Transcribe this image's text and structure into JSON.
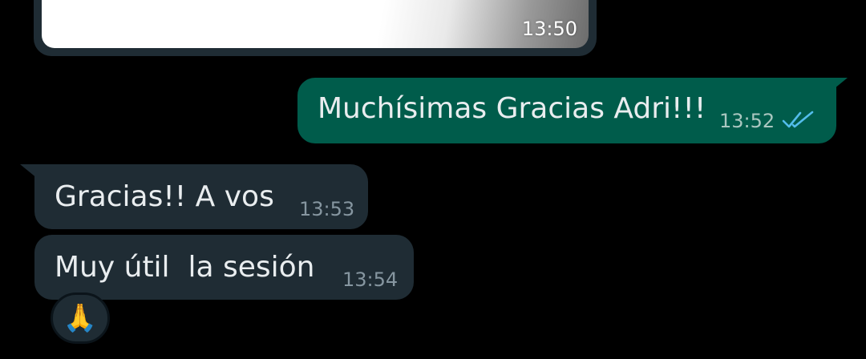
{
  "colors": {
    "background": "#000000",
    "incoming_bubble": "#1f2c34",
    "outgoing_bubble": "#005c4b",
    "message_text": "#e9edef",
    "incoming_time": "#8696a0",
    "outgoing_time": "#aac7c0",
    "read_check": "#53bdeb"
  },
  "messages": [
    {
      "direction": "incoming",
      "type": "image",
      "time": "13:50"
    },
    {
      "direction": "outgoing",
      "text": "Muchísimas Gracias Adri!!!",
      "time": "13:52",
      "status_icon": "double-check-read-icon"
    },
    {
      "direction": "incoming",
      "text": "Gracias!! A vos",
      "time": "13:53"
    },
    {
      "direction": "incoming",
      "text": "Muy útil  la sesión",
      "time": "13:54",
      "reaction": "🙏"
    }
  ]
}
